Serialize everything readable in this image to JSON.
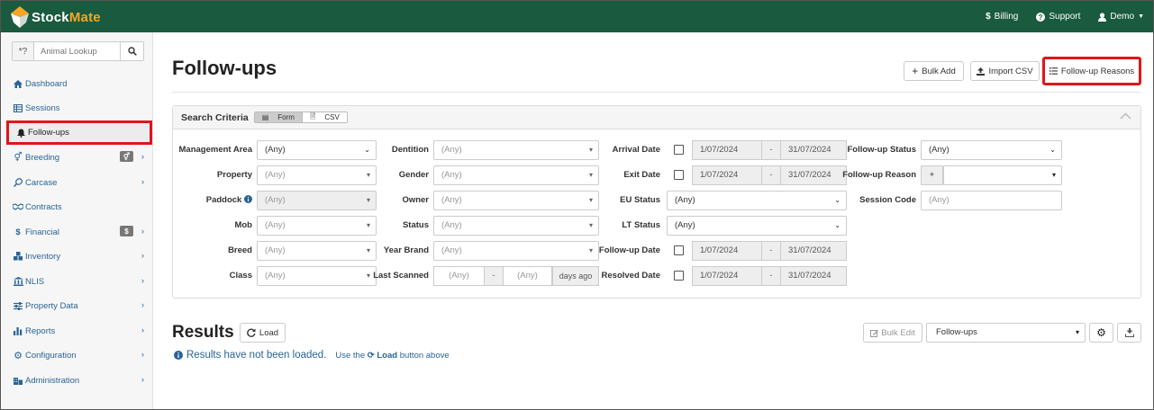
{
  "brand": {
    "name_part1": "Stock",
    "name_part2": "Mate"
  },
  "topnav": {
    "billing": "Billing",
    "support": "Support",
    "user": "Demo"
  },
  "sidebar": {
    "search_prefix": "*?",
    "search_placeholder": "Animal Lookup",
    "items": [
      {
        "label": "Dashboard",
        "icon": "home-icon"
      },
      {
        "label": "Sessions",
        "icon": "table-icon"
      },
      {
        "label": "Follow-ups",
        "icon": "bell-icon"
      },
      {
        "label": "Breeding",
        "icon": "venus-mars-icon"
      },
      {
        "label": "Carcase",
        "icon": "drumstick-icon"
      },
      {
        "label": "Contracts",
        "icon": "handshake-icon"
      },
      {
        "label": "Financial",
        "icon": "dollar-icon",
        "badge": "$"
      },
      {
        "label": "Inventory",
        "icon": "cubes-icon"
      },
      {
        "label": "NLIS",
        "icon": "bank-icon"
      },
      {
        "label": "Property Data",
        "icon": "sliders-icon"
      },
      {
        "label": "Reports",
        "icon": "bar-chart-icon"
      },
      {
        "label": "Configuration",
        "icon": "gear-icon"
      },
      {
        "label": "Administration",
        "icon": "building-icon"
      }
    ]
  },
  "page": {
    "title": "Follow-ups",
    "buttons": {
      "bulk_add": "Bulk Add",
      "import_csv": "Import CSV",
      "follow_up_reasons": "Follow-up Reasons"
    }
  },
  "criteria": {
    "title": "Search Criteria",
    "mode_form": "Form",
    "mode_csv": "CSV",
    "labels": {
      "management_area": "Management Area",
      "property": "Property",
      "paddock": "Paddock",
      "mob": "Mob",
      "breed": "Breed",
      "class": "Class",
      "dentition": "Dentition",
      "gender": "Gender",
      "owner": "Owner",
      "status": "Status",
      "year_brand": "Year Brand",
      "last_scanned": "Last Scanned",
      "arrival_date": "Arrival Date",
      "exit_date": "Exit Date",
      "eu_status": "EU Status",
      "lt_status": "LT Status",
      "follow_up_date": "Follow-up Date",
      "resolved_date": "Resolved Date",
      "follow_up_status": "Follow-up Status",
      "follow_up_reason": "Follow-up Reason",
      "session_code": "Session Code"
    },
    "any": "(Any)",
    "date_from": "1/07/2024",
    "date_to": "31/07/2024",
    "date_sep": "-",
    "days_ago": "days ago",
    "asterisk": "*"
  },
  "results": {
    "title": "Results",
    "load": "Load",
    "bulk_edit": "Bulk Edit",
    "view_select": "Follow-ups",
    "message": "Results have not been loaded.",
    "hint_prefix": "Use the",
    "hint_button": "Load",
    "hint_suffix": "button above"
  },
  "colors": {
    "topbar": "#1a5a3f",
    "accent": "#f5a623",
    "link": "#2a6496",
    "highlight": "#e0151b"
  }
}
